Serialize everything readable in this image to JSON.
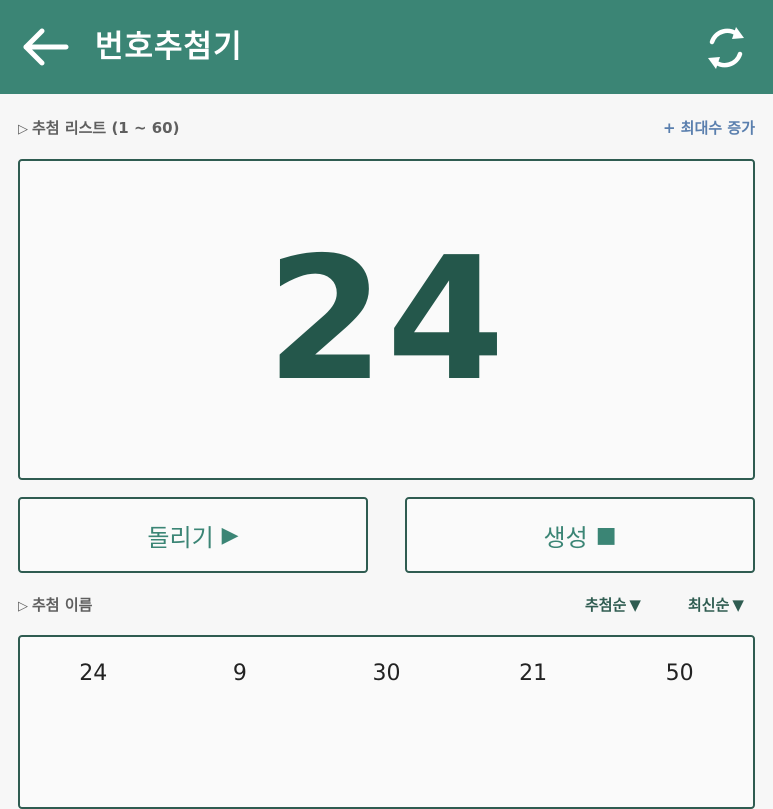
{
  "appbar": {
    "title": "번호추첨기",
    "back_icon": "arrow-left-icon",
    "refresh_icon": "refresh-icon",
    "background": "#3b8575"
  },
  "draw_list": {
    "label_marker": "▷",
    "label": "추첨 리스트 (1 ~ 60)",
    "increase_link": "+ 최대수 증가"
  },
  "result": {
    "number": "24"
  },
  "actions": {
    "spin_label": "돌리기",
    "spin_glyph": "▶",
    "generate_label": "생성",
    "generate_glyph": "■"
  },
  "history": {
    "label_marker": "▷",
    "label": "추첨 이름",
    "sort_draw_order": "추첨순",
    "sort_newest": "최신순",
    "sort_glyph": "▼",
    "numbers": [
      "24",
      "9",
      "30",
      "21",
      "50"
    ]
  },
  "colors": {
    "accent": "#3b8575",
    "dark_accent": "#24574b",
    "link": "#5a7fae"
  }
}
